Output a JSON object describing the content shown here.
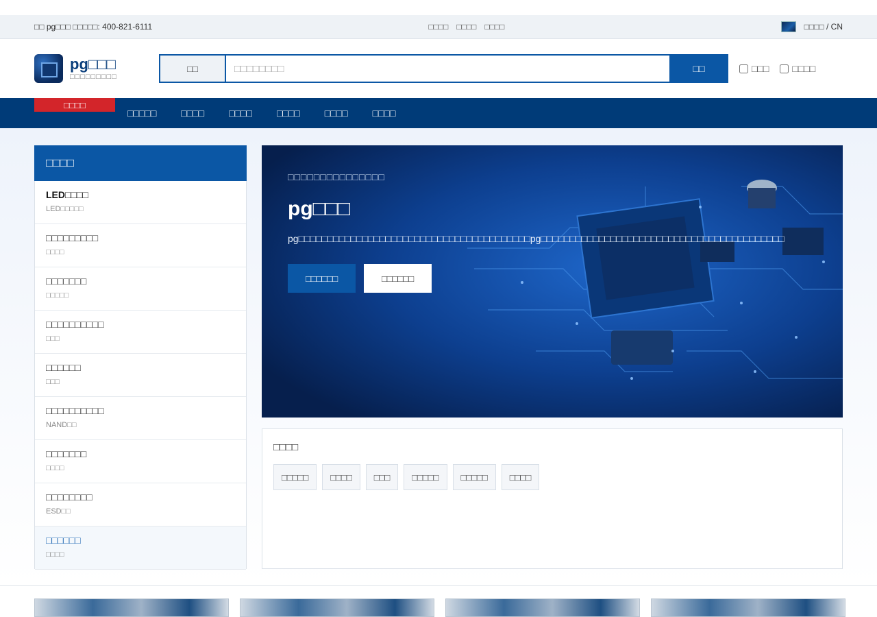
{
  "topbar": {
    "welcome": "□□ pg□□□ □□□□□: 400-821-6111",
    "links": [
      "□□□□",
      "□□□□",
      "□□□□"
    ],
    "lang": "□□□□ / CN"
  },
  "header": {
    "logo_name": "pg□□□",
    "logo_sub": "□□□□□□□□□",
    "search_category": "□□",
    "search_placeholder": "□□□□□□□□",
    "search_button": "□□",
    "check1": "□□□",
    "check2": "□□□□"
  },
  "nav": {
    "all_label": "□□□□",
    "items": [
      "□□□□□",
      "□□□□",
      "□□□□",
      "□□□□",
      "□□□□",
      "□□□□"
    ]
  },
  "sidebar": {
    "title": "□□□□",
    "items": [
      {
        "title": "LED□□□□",
        "sub": "LED□□□□□"
      },
      {
        "title": "□□□□□□□□□",
        "sub": "□□□□"
      },
      {
        "title": "□□□□□□□",
        "sub": "□□□□□"
      },
      {
        "title": "□□□□□□□□□□",
        "sub": "□□□"
      },
      {
        "title": "□□□□□□",
        "sub": "□□□"
      },
      {
        "title": "□□□□□□□□□□",
        "sub": "NAND□□"
      },
      {
        "title": "□□□□□□□",
        "sub": "□□□□"
      },
      {
        "title": "□□□□□□□□",
        "sub": "ESD□□"
      },
      {
        "title": "□□□□□□",
        "sub": "□□□□"
      }
    ]
  },
  "banner": {
    "kicker": "□□□□□□□□□□□□□□□",
    "title": "pg□□□",
    "desc": "pg□□□□□□□□□□□□□□□□□□□□□□□□□□□□□□□□□□□□□□□□pg□□□□□□□□□□□□□□□□□□□□□□□□□□□□□□□□□□□□□□□□□□",
    "btn_primary": "□□□□□□",
    "btn_secondary": "□□□□□□"
  },
  "tags": {
    "title": "□□□□",
    "items": [
      "□□□□□",
      "□□□□",
      "□□□",
      "□□□□□",
      "□□□□□",
      "□□□□"
    ]
  },
  "colors": {
    "primary": "#0b57a5",
    "nav": "#003b78",
    "accent_red": "#d3252a"
  }
}
